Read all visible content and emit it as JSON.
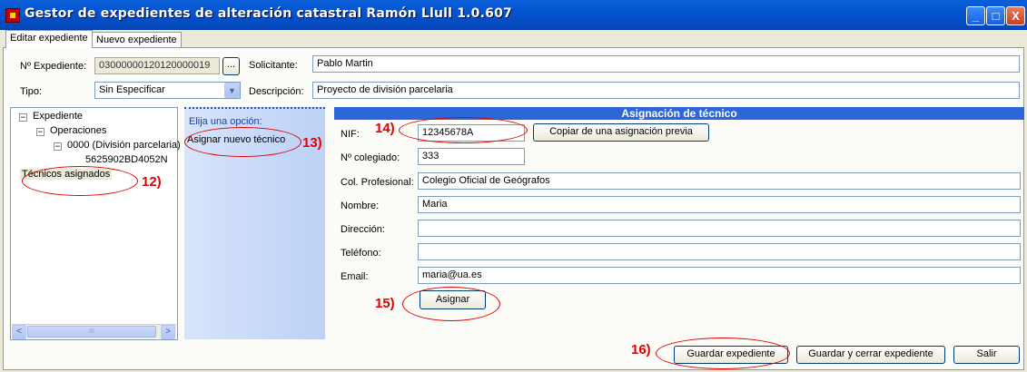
{
  "window": {
    "title": "Gestor de expedientes de alteración catastral Ramón Llull 1.0.607",
    "controls": [
      "_",
      "□",
      "X"
    ]
  },
  "tabs": [
    {
      "label": "Editar expediente",
      "active": true
    },
    {
      "label": "Nuevo expediente",
      "active": false
    }
  ],
  "header": {
    "expediente_label": "Nº Expediente:",
    "expediente_value": "03000000120120000019",
    "browse_label": "...",
    "solicitante_label": "Solicitante:",
    "solicitante_value": "Pablo Martin",
    "tipo_label": "Tipo:",
    "tipo_value": "Sin Especificar",
    "descripcion_label": "Descripción:",
    "descripcion_value": "Proyecto de división parcelaria"
  },
  "tree": {
    "root": "Expediente",
    "operaciones": "Operaciones",
    "operacion": "0000 (División parcelaria)",
    "parcela": "5625902BD4052N",
    "tecnicos": "Técnicos asignados",
    "collapse_glyph": "−",
    "scroll_left": "<",
    "scroll_right": ">",
    "scroll_thumb": "III"
  },
  "options": {
    "title": "Elija una opción:",
    "item": "Asignar nuevo técnico"
  },
  "form": {
    "title": "Asignación de técnico",
    "nif_label": "NIF:",
    "nif_value": "12345678A",
    "copy_button": "Copiar de una asignación previa",
    "colegiado_label": "Nº colegiado:",
    "colegiado_value": "333",
    "col_prof_label": "Col. Profesional:",
    "col_prof_value": "Colegio Oficial de Geógrafos",
    "nombre_label": "Nombre:",
    "nombre_value": "Maria",
    "direccion_label": "Dirección:",
    "direccion_value": "",
    "telefono_label": "Teléfono:",
    "telefono_value": "",
    "email_label": "Email:",
    "email_value": "maria@ua.es",
    "asignar_button": "Asignar"
  },
  "footer": {
    "guardar": "Guardar expediente",
    "guardar_cerrar": "Guardar y cerrar expediente",
    "salir": "Salir"
  },
  "annotations": {
    "n12": "12)",
    "n13": "13)",
    "n14": "14)",
    "n15": "15)",
    "n16": "16)",
    "color": "#e00000"
  },
  "colors": {
    "titlebar": "#0554d0",
    "group_header": "#2c66d8",
    "options_panel": "#c9daf8"
  }
}
